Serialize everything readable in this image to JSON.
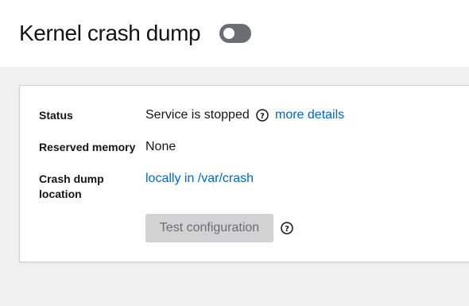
{
  "header": {
    "title": "Kernel crash dump",
    "toggle_on": false
  },
  "card": {
    "status": {
      "label": "Status",
      "value": "Service is stopped",
      "link": "more details"
    },
    "reserved_memory": {
      "label": "Reserved memory",
      "value": "None"
    },
    "location": {
      "label_line1": "Crash dump",
      "label_line2": "location",
      "link": "locally in /var/crash"
    },
    "test_button": "Test configuration"
  },
  "colors": {
    "link": "#0066cc",
    "toggle_off": "#6a6e73",
    "disabled_button_bg": "#d2d2d2"
  },
  "icons": [
    "help-icon"
  ]
}
